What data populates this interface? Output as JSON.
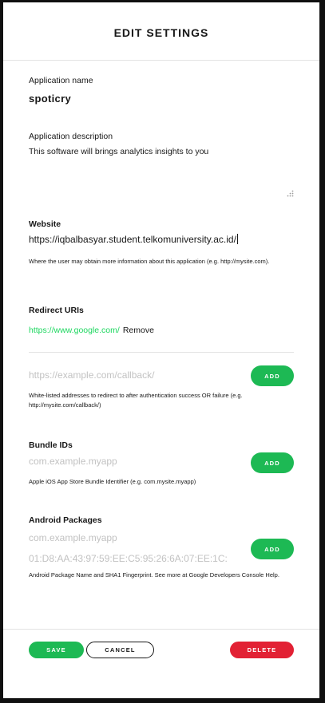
{
  "dialog": {
    "title": "EDIT SETTINGS"
  },
  "app_name": {
    "label": "Application name",
    "value": "spoticry"
  },
  "app_description": {
    "label": "Application description",
    "value": "This software will brings analytics insights to you"
  },
  "website": {
    "label": "Website",
    "value": "https://iqbalbasyar.student.telkomuniversity.ac.id/",
    "help": "Where the user may obtain more information about this application (e.g. http://mysite.com)."
  },
  "redirect_uris": {
    "label": "Redirect URIs",
    "items": [
      {
        "url": "https://www.google.com/",
        "remove_label": "Remove"
      }
    ],
    "input_placeholder": "https://example.com/callback/",
    "add_label": "ADD",
    "help": "White-listed addresses to redirect to after authentication success OR failure (e.g. http://mysite.com/callback/)"
  },
  "bundle_ids": {
    "label": "Bundle IDs",
    "input_placeholder": "com.example.myapp",
    "add_label": "ADD",
    "help": "Apple iOS App Store Bundle Identifier (e.g. com.mysite.myapp)"
  },
  "android_packages": {
    "label": "Android Packages",
    "package_placeholder": "com.example.myapp",
    "fingerprint_placeholder": "01:D8:AA:43:97:59:EE:C5:95:26:6A:07:EE:1C:",
    "add_label": "ADD",
    "help": "Android Package Name and SHA1 Fingerprint. See more at Google Developers Console Help."
  },
  "footer": {
    "save_label": "SAVE",
    "cancel_label": "CANCEL",
    "delete_label": "DELETE"
  },
  "colors": {
    "accent_green": "#1db954",
    "link_green": "#1ed760",
    "danger_red": "#e22134",
    "placeholder_gray": "#c2c2c2"
  },
  "icons": {
    "resize_handle": "resize-grip-icon"
  }
}
